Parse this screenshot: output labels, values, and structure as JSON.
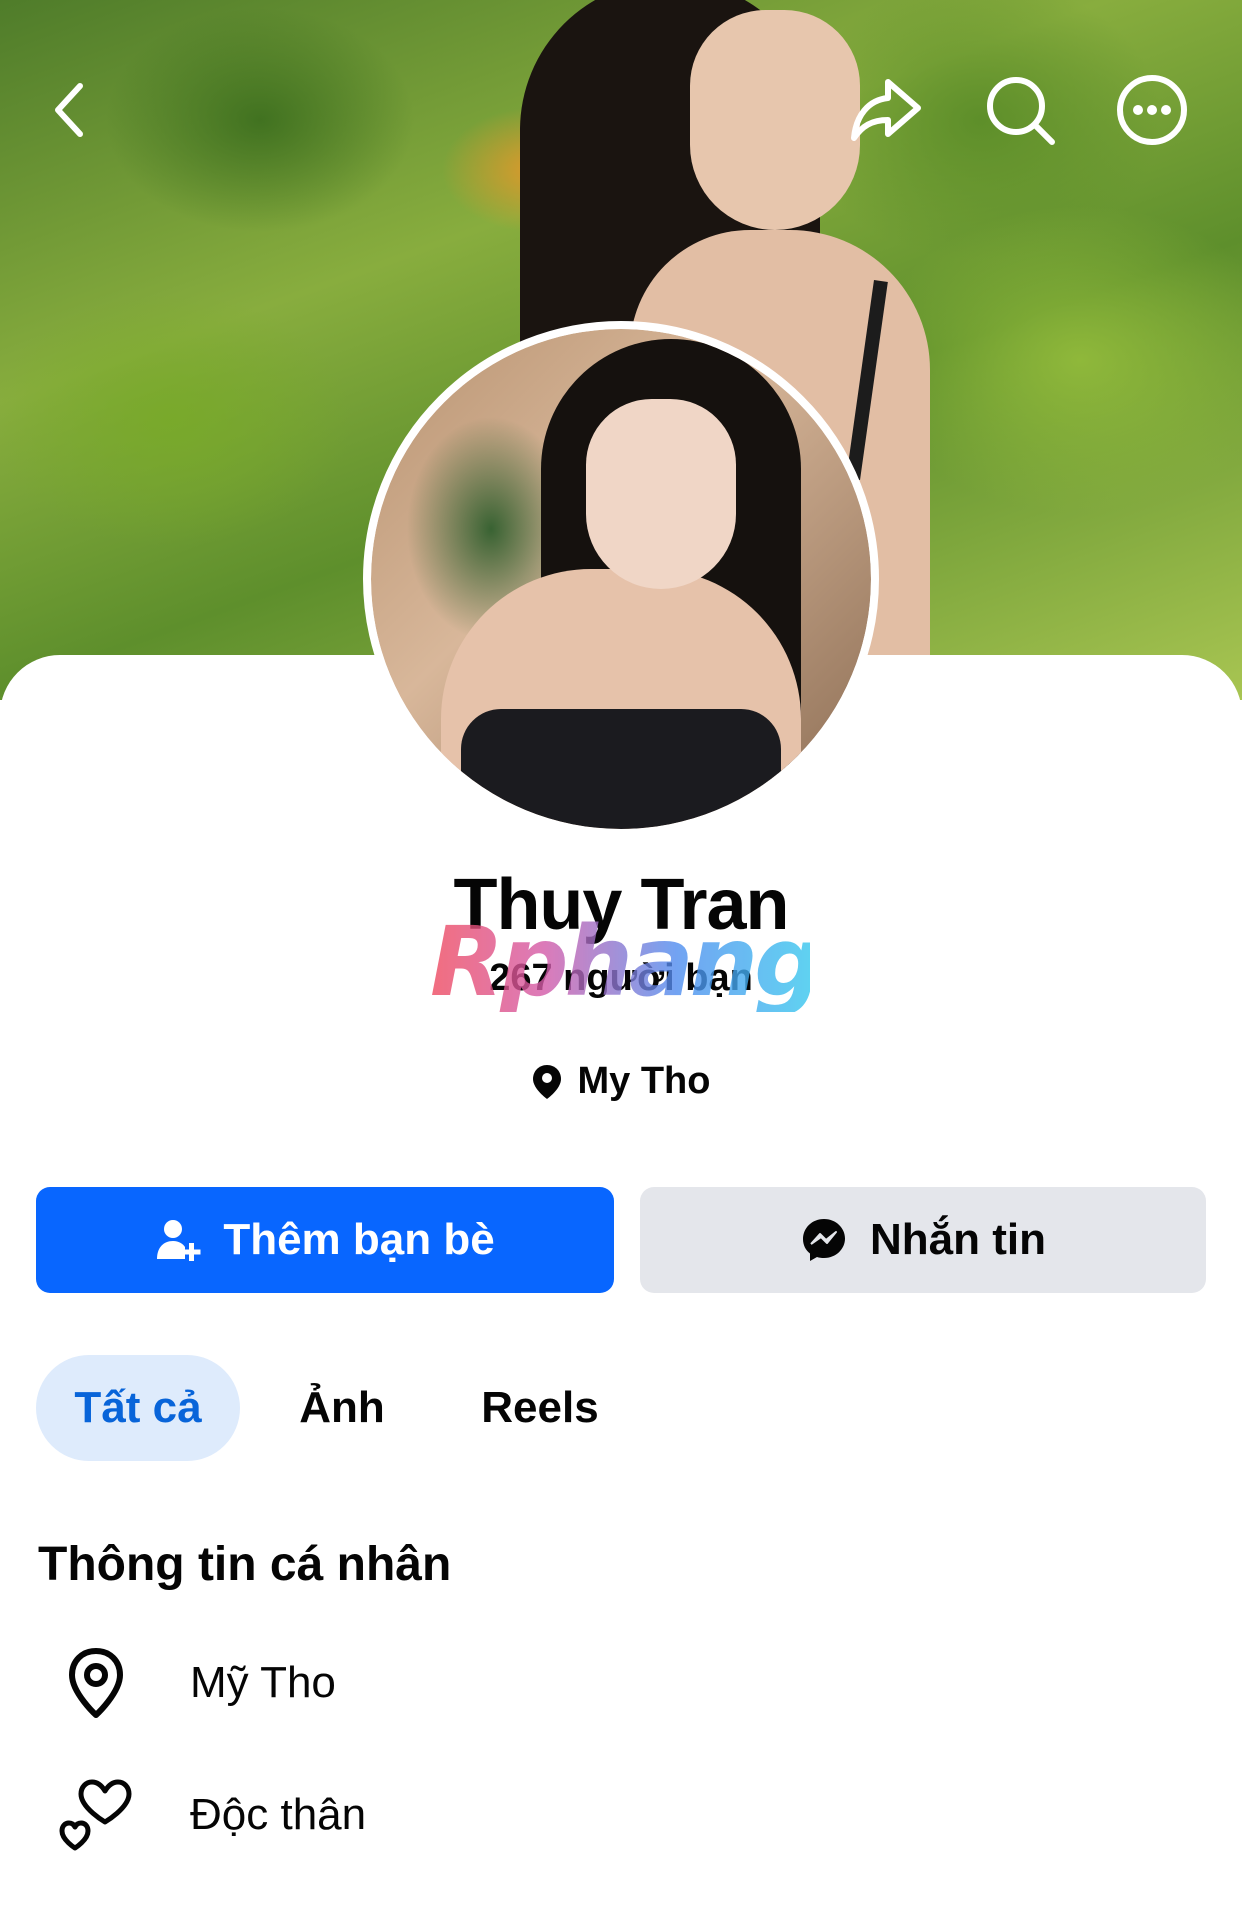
{
  "header": {
    "icons": [
      "back-arrow-icon",
      "share-icon",
      "search-icon",
      "more-options-icon"
    ]
  },
  "profile": {
    "name": "Thuy Tran",
    "friends_count": "267 người bạn",
    "location": "My Tho",
    "watermark": "Rphang"
  },
  "actions": {
    "add_friend_label": "Thêm bạn bè",
    "message_label": "Nhắn tin"
  },
  "tabs": [
    {
      "label": "Tất cả",
      "active": true
    },
    {
      "label": "Ảnh",
      "active": false
    },
    {
      "label": "Reels",
      "active": false
    }
  ],
  "about": {
    "title": "Thông tin cá nhân",
    "items": [
      {
        "icon": "location-pin-icon",
        "text": "Mỹ Tho"
      },
      {
        "icon": "hearts-icon",
        "text": "Độc thân"
      }
    ]
  },
  "colors": {
    "primary_blue": "#0866ff",
    "active_tab_bg": "#deebfc",
    "active_tab_text": "#0864d9",
    "secondary_button_bg": "#e4e6eb"
  }
}
